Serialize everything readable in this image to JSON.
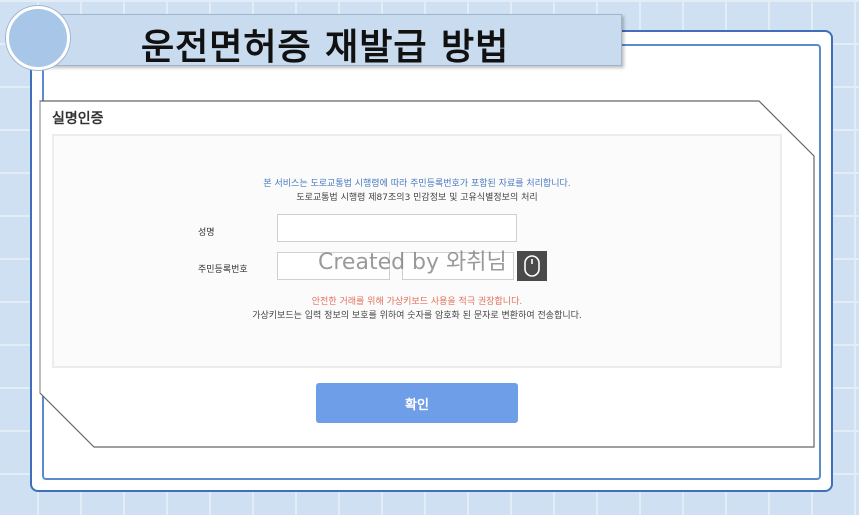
{
  "title": "운전면허증 재발급 방법",
  "form": {
    "section_title": "실명인증",
    "notice_line1": "본 서비스는 도로교통법 시행령에 따라 주민등록번호가 포함된 자료를 처리합니다.",
    "notice_line2": "도로교통법 시행령 제87조의3 민감정보 및 고유식별정보의 처리",
    "name_label": "성명",
    "name_value": "",
    "rrn_label": "주민등록번호",
    "rrn_front_value": "",
    "rrn_back_value": "",
    "warning_line1": "안전한 거래를 위해 가상키보드 사용을 적극 권장합니다.",
    "warning_line2": "가상키보드는 입력 정보의 보호를 위하여 숫자를 암호화 된 문자로 변환하여 전송합니다.",
    "confirm_label": "확인"
  },
  "icons": {
    "virtual_keyboard": "mouse-icon"
  },
  "watermark": "Created by 와취님",
  "colors": {
    "background": "#cfe0f3",
    "frame": "#3f6fb8",
    "notice_blue": "#4a7ac0",
    "warning_red": "#e2705a",
    "button": "#6f9ee8"
  }
}
